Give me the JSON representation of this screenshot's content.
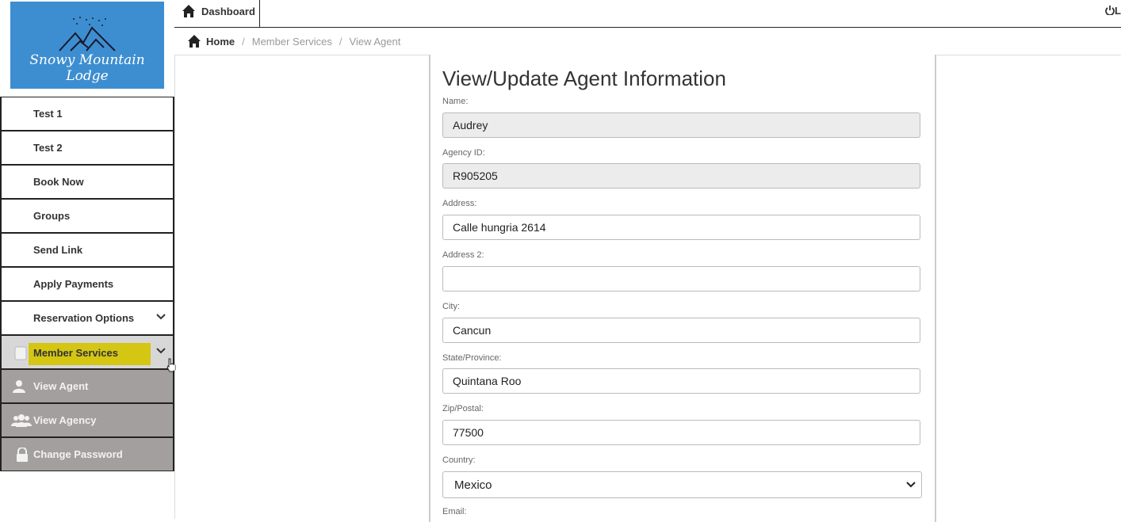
{
  "brand": {
    "logo_text": "Snowy Mountain Lodge"
  },
  "topbar": {
    "dashboard_label": "Dashboard",
    "logout_label": "L"
  },
  "breadcrumb": {
    "home": "Home",
    "section": "Member Services",
    "current": "View Agent"
  },
  "sidebar": {
    "items": [
      {
        "label": "Test 1"
      },
      {
        "label": "Test 2"
      },
      {
        "label": "Book Now"
      },
      {
        "label": "Groups"
      },
      {
        "label": "Send Link"
      },
      {
        "label": "Apply Payments"
      },
      {
        "label": "Reservation Options"
      }
    ],
    "active": {
      "label": "Member Services"
    },
    "subitems": [
      {
        "label": "View Agent",
        "icon": "user-icon"
      },
      {
        "label": "View Agency",
        "icon": "users-icon"
      },
      {
        "label": "Change Password",
        "icon": "lock-icon"
      }
    ]
  },
  "form": {
    "title": "View/Update Agent Information",
    "name": {
      "label": "Name:",
      "value": "Audrey"
    },
    "agency_id": {
      "label": "Agency ID:",
      "value": "R905205"
    },
    "address": {
      "label": "Address:",
      "value": "Calle hungria 2614"
    },
    "address2": {
      "label": "Address 2:",
      "value": ""
    },
    "city": {
      "label": "City:",
      "value": "Cancun"
    },
    "state": {
      "label": "State/Province:",
      "value": "Quintana Roo"
    },
    "zip": {
      "label": "Zip/Postal:",
      "value": "77500"
    },
    "country": {
      "label": "Country:",
      "value": "Mexico"
    },
    "email": {
      "label": "Email:"
    }
  },
  "colors": {
    "highlight": "#d4c613",
    "submenu_bg": "#a49f9f",
    "logo_bg": "#3d8ed0"
  }
}
